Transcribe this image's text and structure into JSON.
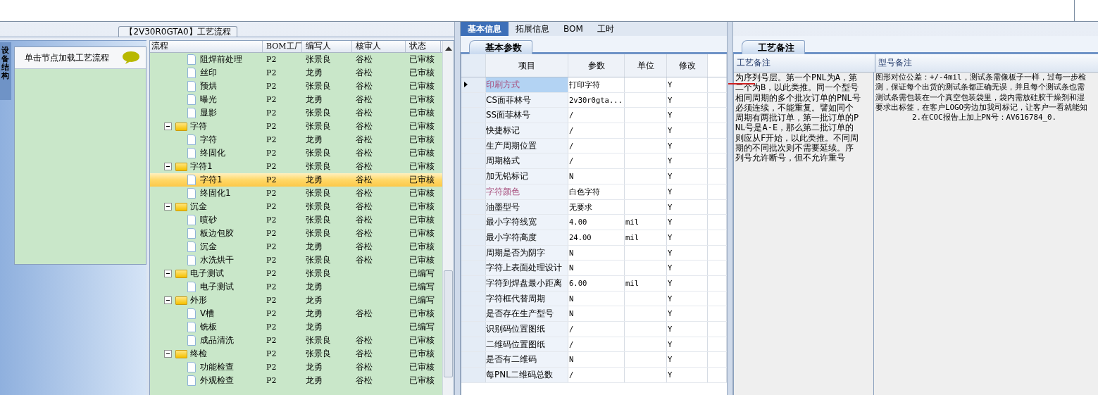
{
  "left_panel": {
    "title": "【2V30R0GTA0】工艺流程",
    "side_tab": "设备结构",
    "hint": "单击节点加载工艺流程"
  },
  "process_tree": {
    "columns": [
      "流程",
      "BOM工厂",
      "编写人",
      "核审人",
      "状态"
    ],
    "rows": [
      {
        "kind": "file",
        "label": "阻焊前处理",
        "bom": "P2",
        "writer": "张景良",
        "reviewer": "谷松",
        "status": "已审核",
        "selected": false
      },
      {
        "kind": "file",
        "label": "丝印",
        "bom": "P2",
        "writer": "龙勇",
        "reviewer": "谷松",
        "status": "已审核",
        "selected": false
      },
      {
        "kind": "file",
        "label": "预烘",
        "bom": "P2",
        "writer": "张景良",
        "reviewer": "谷松",
        "status": "已审核",
        "selected": false
      },
      {
        "kind": "file",
        "label": "曝光",
        "bom": "P2",
        "writer": "龙勇",
        "reviewer": "谷松",
        "status": "已审核",
        "selected": false
      },
      {
        "kind": "file",
        "label": "显影",
        "bom": "P2",
        "writer": "张景良",
        "reviewer": "谷松",
        "status": "已审核",
        "selected": false
      },
      {
        "kind": "folder",
        "label": "字符",
        "bom": "P2",
        "writer": "张景良",
        "reviewer": "谷松",
        "status": "已审核",
        "selected": false,
        "expanded": true,
        "children": [
          {
            "kind": "file",
            "label": "字符",
            "bom": "P2",
            "writer": "龙勇",
            "reviewer": "谷松",
            "status": "已审核",
            "selected": false
          },
          {
            "kind": "file",
            "label": "终固化",
            "bom": "P2",
            "writer": "张景良",
            "reviewer": "谷松",
            "status": "已审核",
            "selected": false
          }
        ]
      },
      {
        "kind": "folder",
        "label": "字符1",
        "bom": "P2",
        "writer": "张景良",
        "reviewer": "谷松",
        "status": "已审核",
        "selected": false,
        "expanded": true,
        "children": [
          {
            "kind": "file",
            "label": "字符1",
            "bom": "P2",
            "writer": "龙勇",
            "reviewer": "谷松",
            "status": "已审核",
            "selected": true
          },
          {
            "kind": "file",
            "label": "终固化1",
            "bom": "P2",
            "writer": "张景良",
            "reviewer": "谷松",
            "status": "已审核",
            "selected": false
          }
        ]
      },
      {
        "kind": "folder",
        "label": "沉金",
        "bom": "P2",
        "writer": "张景良",
        "reviewer": "谷松",
        "status": "已审核",
        "selected": false,
        "expanded": true,
        "children": [
          {
            "kind": "file",
            "label": "喷砂",
            "bom": "P2",
            "writer": "张景良",
            "reviewer": "谷松",
            "status": "已审核",
            "selected": false
          },
          {
            "kind": "file",
            "label": "板边包胶",
            "bom": "P2",
            "writer": "张景良",
            "reviewer": "谷松",
            "status": "已审核",
            "selected": false
          },
          {
            "kind": "file",
            "label": "沉金",
            "bom": "P2",
            "writer": "龙勇",
            "reviewer": "谷松",
            "status": "已审核",
            "selected": false
          },
          {
            "kind": "file",
            "label": "水洗烘干",
            "bom": "P2",
            "writer": "张景良",
            "reviewer": "谷松",
            "status": "已审核",
            "selected": false
          }
        ]
      },
      {
        "kind": "folder",
        "label": "电子测试",
        "bom": "P2",
        "writer": "张景良",
        "status": "已编写",
        "selected": false,
        "expanded": true,
        "children": [
          {
            "kind": "file",
            "label": "电子测试",
            "bom": "P2",
            "writer": "龙勇",
            "status": "已编写",
            "selected": false
          }
        ]
      },
      {
        "kind": "folder",
        "label": "外形",
        "bom": "P2",
        "writer": "龙勇",
        "status": "已编写",
        "selected": false,
        "expanded": true,
        "children": [
          {
            "kind": "file",
            "label": "V槽",
            "bom": "P2",
            "writer": "龙勇",
            "reviewer": "谷松",
            "status": "已审核",
            "selected": false
          },
          {
            "kind": "file",
            "label": "铣板",
            "bom": "P2",
            "writer": "龙勇",
            "status": "已编写",
            "selected": false
          },
          {
            "kind": "file",
            "label": "成品清洗",
            "bom": "P2",
            "writer": "张景良",
            "reviewer": "谷松",
            "status": "已审核",
            "selected": false
          }
        ]
      },
      {
        "kind": "folder",
        "label": "终检",
        "bom": "P2",
        "writer": "张景良",
        "reviewer": "谷松",
        "status": "已审核",
        "selected": false,
        "expanded": true,
        "children": [
          {
            "kind": "file",
            "label": "功能检查",
            "bom": "P2",
            "writer": "龙勇",
            "reviewer": "谷松",
            "status": "已审核",
            "selected": false
          },
          {
            "kind": "file",
            "label": "外观检查",
            "bom": "P2",
            "writer": "龙勇",
            "reviewer": "谷松",
            "status": "已审核",
            "selected": false
          }
        ]
      }
    ]
  },
  "info_tabs": [
    {
      "label": "基本信息",
      "selected": true
    },
    {
      "label": "拓展信息",
      "selected": false
    },
    {
      "label": "BOM",
      "selected": false
    },
    {
      "label": "工时",
      "selected": false
    }
  ],
  "params": {
    "tab": "基本参数",
    "columns": [
      "项目",
      "参数",
      "单位",
      "修改"
    ],
    "rows": [
      {
        "item": "印刷方式",
        "emphasized": true,
        "value": "打印字符",
        "modify": "Y",
        "selected": true
      },
      {
        "item": "CS面菲林号",
        "emphasized": false,
        "value": "2v30r0gta...",
        "modify": "Y",
        "selected": false
      },
      {
        "item": "SS面菲林号",
        "emphasized": false,
        "value": "/",
        "modify": "Y",
        "selected": false
      },
      {
        "item": "快捷标记",
        "emphasized": false,
        "value": "/",
        "modify": "Y",
        "selected": false
      },
      {
        "item": "生产周期位置",
        "emphasized": false,
        "value": "/",
        "modify": "Y",
        "selected": false
      },
      {
        "item": "周期格式",
        "emphasized": false,
        "value": "/",
        "modify": "Y",
        "selected": false
      },
      {
        "item": "加无铅标记",
        "emphasized": false,
        "value": "N",
        "modify": "Y",
        "selected": false
      },
      {
        "item": "字符颜色",
        "emphasized": true,
        "value": "白色字符",
        "modify": "Y",
        "selected": false
      },
      {
        "item": "油墨型号",
        "emphasized": false,
        "value": "无要求",
        "modify": "Y",
        "selected": false
      },
      {
        "item": "最小字符线宽",
        "emphasized": false,
        "value": "4.00",
        "unit": "mil",
        "modify": "Y",
        "selected": false
      },
      {
        "item": "最小字符高度",
        "emphasized": false,
        "value": "24.00",
        "unit": "mil",
        "modify": "Y",
        "selected": false
      },
      {
        "item": "周期是否为阴字",
        "emphasized": false,
        "value": "N",
        "modify": "Y",
        "selected": false
      },
      {
        "item": "字符上表面处理设计",
        "emphasized": false,
        "value": "N",
        "modify": "Y",
        "selected": false
      },
      {
        "item": "字符到焊盘最小距离",
        "emphasized": false,
        "value": "6.00",
        "unit": "mil",
        "modify": "Y",
        "selected": false
      },
      {
        "item": "字符框代替周期",
        "emphasized": false,
        "value": "N",
        "modify": "Y",
        "selected": false
      },
      {
        "item": "是否存在生产型号",
        "emphasized": false,
        "value": "N",
        "modify": "Y",
        "selected": false
      },
      {
        "item": "识别码位置图纸",
        "emphasized": false,
        "value": "/",
        "modify": "Y",
        "selected": false
      },
      {
        "item": "二维码位置图纸",
        "emphasized": false,
        "value": "/",
        "modify": "Y",
        "selected": false
      },
      {
        "item": "是否有二维码",
        "emphasized": false,
        "value": "N",
        "modify": "Y",
        "selected": false
      },
      {
        "item": "每PNL二维码总数",
        "emphasized": false,
        "value": "/",
        "modify": "Y",
        "selected": false
      }
    ]
  },
  "notes": {
    "tab": "工艺备注",
    "columns": [
      "工艺备注",
      "型号备注"
    ],
    "process_note": "为序列号层。第一个PNL为A，第二个为B，以此类推。同一个型号相同周期的多个批次订单的PNL号必须连续，不能重复。譬如同个周期有两批订单，第一批订单的PNL号是A-E，那么第二批订单的则应从F开始，以此类推。不同周期的不同批次则不需要延续。序列号允许断号，但不允许重号",
    "model_note_lines": [
      "图形对位公差：+/-4mil，测试条需像板子一样，过每一步检",
      "测，保证每个出货的测试条都正确无误，并且每个测试条也需",
      "测试条需包装在一个真空包装袋里，袋内需放硅胶干燥剂和湿",
      "要求出标签，在客户LOGO旁边加我司标记，让客户一看就能知",
      "        2.在COC报告上加上PN号：AV616784_0."
    ]
  }
}
